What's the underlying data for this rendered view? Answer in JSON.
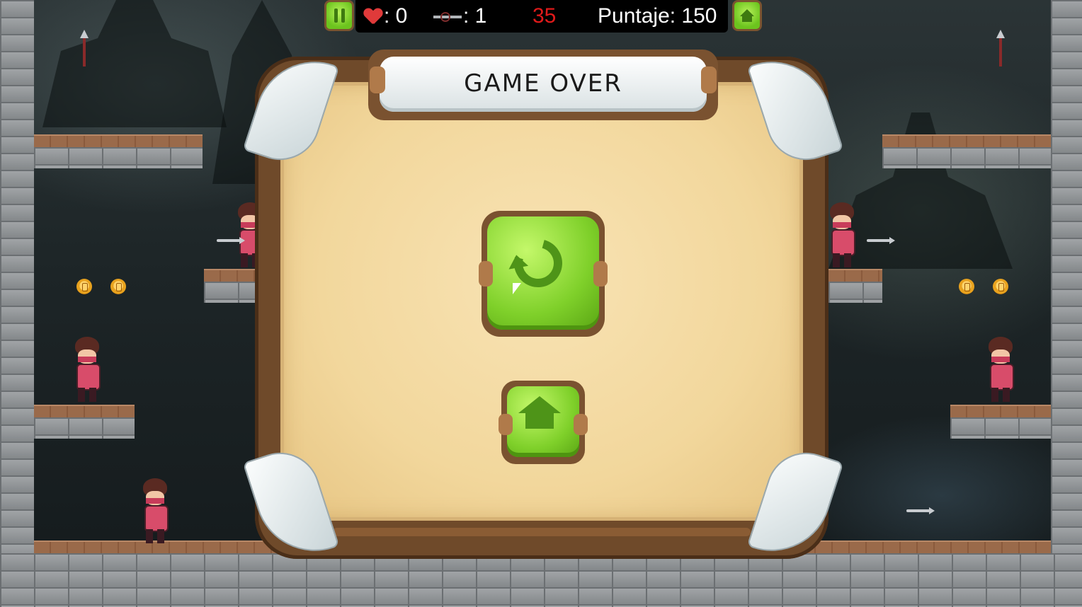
{
  "hud": {
    "lives_label": ": 0",
    "kunai_label": ": 1",
    "timer": "35",
    "score_label": "Puntaje: 150",
    "timer_color": "#e01a1a"
  },
  "dialog": {
    "title": "GAME OVER",
    "buttons": [
      "retry",
      "home"
    ]
  },
  "icons": {
    "pause": "pause-icon",
    "home_hud": "home-icon",
    "lives": "heart-icon",
    "kunai": "kunai-icon",
    "retry": "retry-icon",
    "home": "home-icon"
  },
  "colors": {
    "accent_green": "#7fd02a",
    "frame_brown": "#7a5230",
    "parchment": "#f2d79c"
  }
}
